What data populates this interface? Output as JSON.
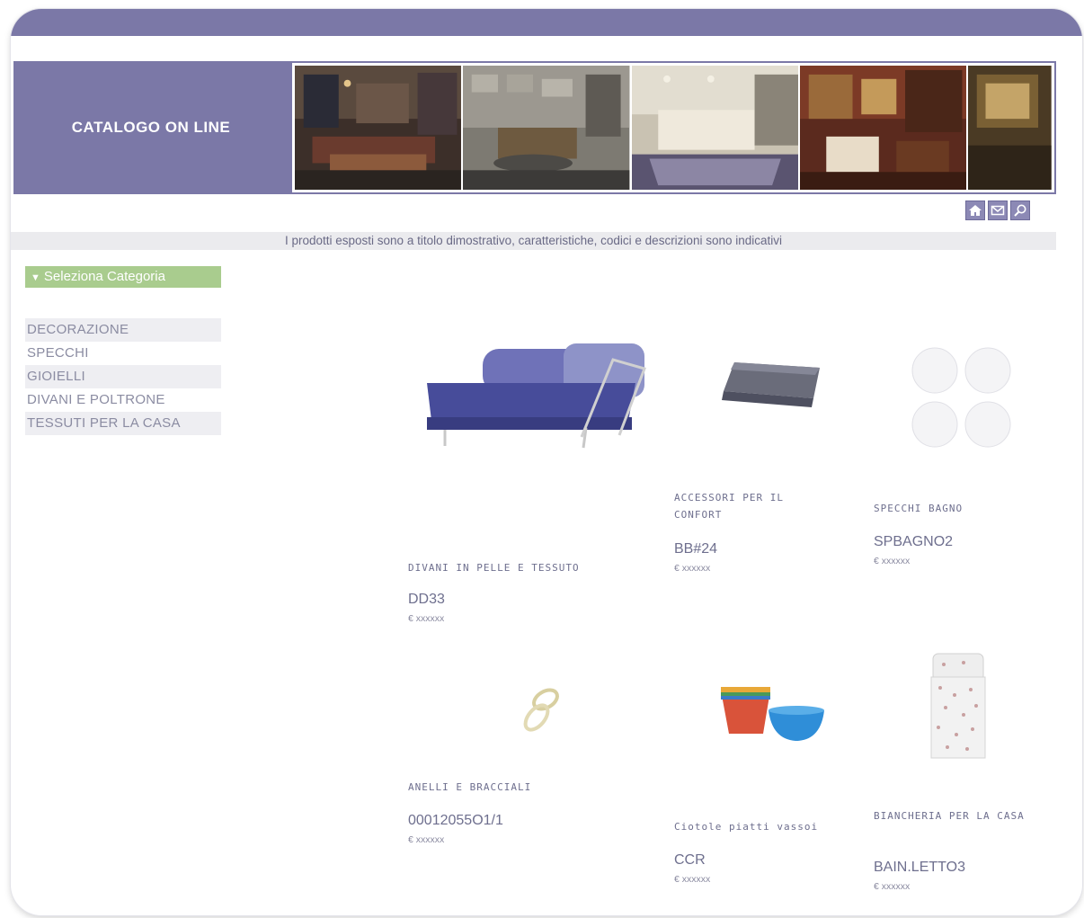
{
  "header": {
    "title": "CATALOGO ON LINE"
  },
  "colors": {
    "brand": "#7b78a7",
    "category_button": "#a9cc8e",
    "text": "#6e6f8e"
  },
  "toolbar": {
    "icons": [
      "home-icon",
      "mail-icon",
      "search-icon"
    ]
  },
  "disclaimer": "I prodotti esposti sono a titolo dimostrativo, caratteristiche, codici e descrizioni sono indicativi",
  "sidebar": {
    "select_label": "Seleziona Categoria",
    "categories": [
      {
        "label": "DECORAZIONE"
      },
      {
        "label": "SPECCHI"
      },
      {
        "label": "GIOIELLI"
      },
      {
        "label": "DIVANI E POLTRONE"
      },
      {
        "label": "TESSUTI PER LA CASA"
      }
    ]
  },
  "products": [
    {
      "name": "DIVANI IN PELLE E TESSUTO",
      "code": "DD33",
      "price": "€ xxxxxx"
    },
    {
      "name": "ACCESSORI PER IL CONFORT",
      "code": "BB#24",
      "price": "€ xxxxxx"
    },
    {
      "name": "SPECCHI BAGNO",
      "code": "SPBAGNO2",
      "price": "€ xxxxxx"
    },
    {
      "name": "ANELLI E BRACCIALI",
      "code": "00012055O1/1",
      "price": "€ xxxxxx"
    },
    {
      "name": "Ciotole piatti vassoi",
      "code": "CCR",
      "price": "€ xxxxxx"
    },
    {
      "name": "BIANCHERIA PER LA CASA",
      "code": "BAIN.LETTO3",
      "price": "€ xxxxxx"
    }
  ]
}
